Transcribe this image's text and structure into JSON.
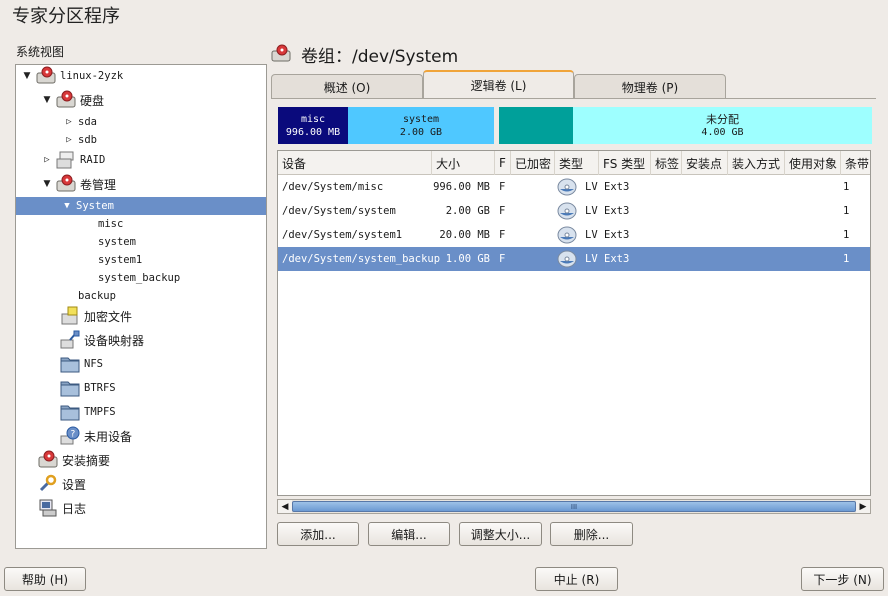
{
  "app_title": "专家分区程序",
  "system_view_label": "系统视图",
  "tree": [
    {
      "label": "linux-2yzk",
      "icon": "host-icon",
      "expanded": true
    },
    {
      "label": "硬盘",
      "icon": "harddisk-icon",
      "expanded": true
    },
    {
      "label": "sda",
      "collapsed": true
    },
    {
      "label": "sdb",
      "collapsed": true
    },
    {
      "label": "RAID",
      "icon": "raid-icon",
      "collapsed": true
    },
    {
      "label": "卷管理",
      "icon": "volume-manager-icon",
      "expanded": true
    },
    {
      "label": "System",
      "expanded": true,
      "selected": true
    },
    {
      "label": "misc"
    },
    {
      "label": "system"
    },
    {
      "label": "system1"
    },
    {
      "label": "system_backup"
    },
    {
      "label": "backup"
    },
    {
      "label": "加密文件",
      "icon": "crypt-file-icon"
    },
    {
      "label": "设备映射器",
      "icon": "device-mapper-icon"
    },
    {
      "label": "NFS",
      "icon": "folder-icon"
    },
    {
      "label": "BTRFS",
      "icon": "folder-icon"
    },
    {
      "label": "TMPFS",
      "icon": "folder-icon"
    },
    {
      "label": "未用设备",
      "icon": "unused-device-icon"
    },
    {
      "label": "安装摘要",
      "icon": "summary-icon"
    },
    {
      "label": "设置",
      "icon": "settings-icon"
    },
    {
      "label": "日志",
      "icon": "log-icon"
    }
  ],
  "volume_group": {
    "title": "卷组：/dev/System",
    "icon": "volume-group-icon"
  },
  "tabs": [
    {
      "label": "概述 (O)",
      "active": false
    },
    {
      "label": "逻辑卷 (L)",
      "active": true
    },
    {
      "label": "物理卷 (P)",
      "active": false
    }
  ],
  "volume_bar": {
    "segments": [
      {
        "name": "misc",
        "size": "996.00 MB",
        "color": "#0a0a7c",
        "text_color": "#ffffff"
      },
      {
        "name": "system",
        "size": "2.00 GB",
        "color": "#4fc8ff",
        "text_color": "#1a1a1a"
      },
      {
        "name": "",
        "size": "",
        "color": "#00a09a",
        "text_color": "#1a1a1a"
      },
      {
        "name": "未分配",
        "size": "4.00 GB",
        "color": "#9effff",
        "text_color": "#1a1a1a"
      }
    ]
  },
  "table": {
    "columns": [
      "设备",
      "大小",
      "F",
      "已加密",
      "类型",
      "FS 类型",
      "标签",
      "安装点",
      "装入方式",
      "使用对象",
      "条带"
    ],
    "rows": [
      {
        "device": "/dev/System/misc",
        "size": "996.00 MB",
        "f": "F",
        "encrypted": "",
        "type": "LV",
        "fs_type": "Ext3",
        "label": "",
        "mount": "",
        "mount_by": "",
        "used_by": "",
        "stripes": "1",
        "selected": false
      },
      {
        "device": "/dev/System/system",
        "size": "2.00 GB",
        "f": "F",
        "encrypted": "",
        "type": "LV",
        "fs_type": "Ext3",
        "label": "",
        "mount": "",
        "mount_by": "",
        "used_by": "",
        "stripes": "1",
        "selected": false
      },
      {
        "device": "/dev/System/system1",
        "size": "20.00 MB",
        "f": "F",
        "encrypted": "",
        "type": "LV",
        "fs_type": "Ext3",
        "label": "",
        "mount": "",
        "mount_by": "",
        "used_by": "",
        "stripes": "1",
        "selected": false
      },
      {
        "device": "/dev/System/system_backup",
        "size": "1.00 GB",
        "f": "F",
        "encrypted": "",
        "type": "LV",
        "fs_type": "Ext3",
        "label": "",
        "mount": "",
        "mount_by": "",
        "used_by": "",
        "stripes": "1",
        "selected": true
      }
    ]
  },
  "scrollbar": {
    "thumb_grip": "III"
  },
  "actions": {
    "add": "添加...",
    "edit": "编辑...",
    "resize": "调整大小...",
    "delete": "删除..."
  },
  "footer": {
    "help": "帮助 (H)",
    "abort": "中止 (R)",
    "next": "下一步 (N)"
  }
}
